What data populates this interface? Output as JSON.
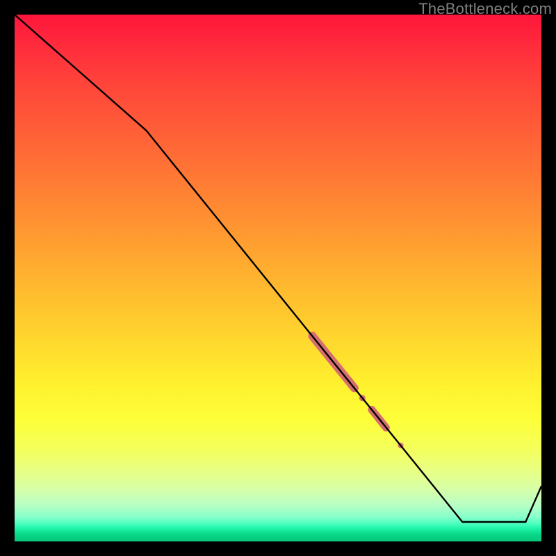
{
  "watermark": "TheBottleneck.com",
  "colors": {
    "curve": "#000000",
    "marker": "#d66d6e",
    "frame_bg": "#000000"
  },
  "chart_data": {
    "type": "line",
    "title": "",
    "xlabel": "",
    "ylabel": "",
    "xlim": [
      0,
      100
    ],
    "ylim": [
      0,
      100
    ],
    "grid": false,
    "legend": false,
    "series": [
      {
        "name": "curve",
        "x": [
          0,
          25,
          85,
          97,
          100
        ],
        "y": [
          100,
          78,
          3.7,
          3.7,
          10.5
        ],
        "line_width": 2,
        "color": "#000000"
      }
    ],
    "markers": [
      {
        "name": "cluster-a",
        "x_start": 56.5,
        "y_start": 39.0,
        "x_end": 64.5,
        "y_end": 29.1,
        "width": 12
      },
      {
        "name": "cluster-b-dot",
        "x_start": 66.0,
        "y_start": 27.2,
        "x_end": 66.0,
        "y_end": 27.2,
        "width": 9
      },
      {
        "name": "cluster-c",
        "x_start": 67.8,
        "y_start": 25.0,
        "x_end": 70.5,
        "y_end": 21.6,
        "width": 11
      },
      {
        "name": "cluster-d-dot",
        "x_start": 73.3,
        "y_start": 18.2,
        "x_end": 73.3,
        "y_end": 18.2,
        "width": 8
      }
    ],
    "marker_color": "#d66d6e"
  }
}
